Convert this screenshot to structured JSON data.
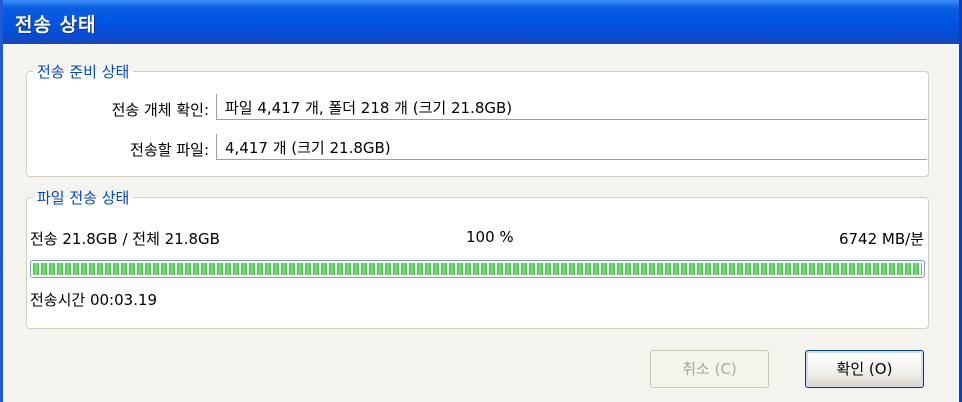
{
  "window": {
    "title": "전송 상태"
  },
  "prep_group": {
    "legend": "전송 준비 상태",
    "rows": [
      {
        "label": "전송 개체 확인:",
        "value": "파일 4,417 개, 폴더 218 개 (크기 21.8GB)"
      },
      {
        "label": "전송할 파일:",
        "value": "4,417 개 (크기 21.8GB)"
      }
    ]
  },
  "transfer_group": {
    "legend": "파일 전송 상태",
    "transferred": "전송 21.8GB / 전체 21.8GB",
    "percent_text": "100 %",
    "speed": "6742 MB/분",
    "progress_fraction": 1.0,
    "elapsed": "전송시간 00:03.19"
  },
  "buttons": {
    "cancel": {
      "label": "취소 (C)",
      "enabled": false
    },
    "ok": {
      "label": "확인 (O)",
      "enabled": true
    }
  },
  "colors": {
    "titlebar": "#0055e5",
    "legend": "#0046d5",
    "progress": "#3fc03f"
  }
}
